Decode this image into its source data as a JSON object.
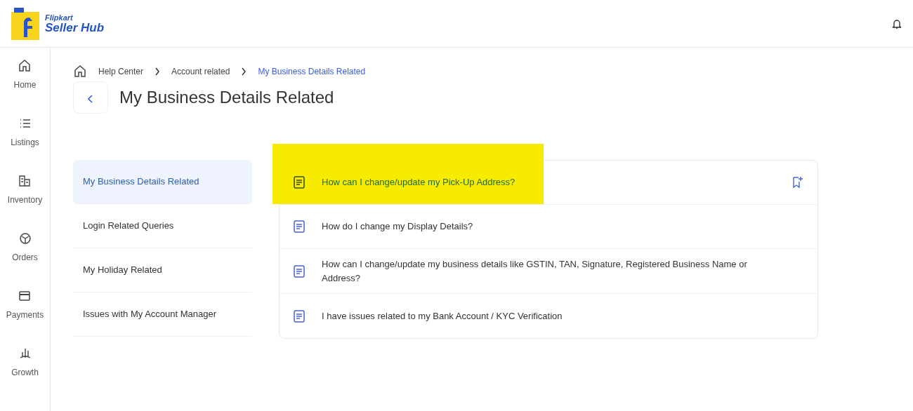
{
  "header": {
    "brand_top": "Flipkart",
    "brand_bottom": "Seller Hub"
  },
  "sidebar": {
    "items": [
      {
        "label": "Home"
      },
      {
        "label": "Listings"
      },
      {
        "label": "Inventory"
      },
      {
        "label": "Orders"
      },
      {
        "label": "Payments"
      },
      {
        "label": "Growth"
      }
    ]
  },
  "breadcrumb": [
    {
      "label": "Help Center",
      "selected": false
    },
    {
      "label": "Account related",
      "selected": false
    },
    {
      "label": "My Business Details Related",
      "selected": true
    }
  ],
  "page_title": "My Business Details Related",
  "categories": [
    {
      "label": "My Business Details Related",
      "selected": true
    },
    {
      "label": "Login Related Queries",
      "selected": false
    },
    {
      "label": "My Holiday Related",
      "selected": false
    },
    {
      "label": "Issues with My Account Manager",
      "selected": false
    }
  ],
  "questions": [
    {
      "text": "How can I change/update my Pick-Up Address?",
      "highlighted": true,
      "bookmark": true
    },
    {
      "text": "How do I change my Display Details?",
      "highlighted": false,
      "bookmark": false
    },
    {
      "text": "How can I change/update my business details like GSTIN, TAN, Signature, Registered Business Name or Address?",
      "highlighted": false,
      "bookmark": false
    },
    {
      "text": "I have issues related to my Bank Account / KYC Verification",
      "highlighted": false,
      "bookmark": false
    }
  ]
}
